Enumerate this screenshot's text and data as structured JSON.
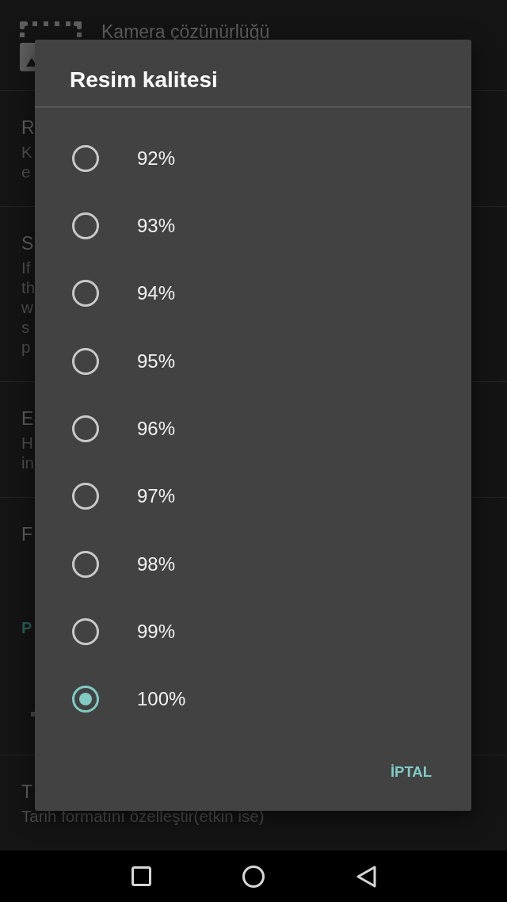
{
  "settings": [
    {
      "kind": "image_item",
      "title": "Kamera çözünürlüğü"
    },
    {
      "kind": "item",
      "title": "R",
      "summary": [
        "K",
        "e"
      ]
    },
    {
      "kind": "item",
      "title": "S",
      "summary": [
        "If",
        "th",
        "w",
        "s",
        "p"
      ]
    },
    {
      "kind": "item",
      "title": "E",
      "summary": [
        "H",
        "in"
      ]
    },
    {
      "kind": "item",
      "title": "F"
    },
    {
      "kind": "category",
      "title": "P"
    },
    {
      "kind": "slider"
    },
    {
      "kind": "item",
      "title": "T",
      "summary": [
        "Tarih formatını özelleştir(etkin ise)"
      ]
    }
  ],
  "dialog": {
    "title": "Resim kalitesi",
    "options": [
      {
        "label": "92%",
        "selected": false
      },
      {
        "label": "93%",
        "selected": false
      },
      {
        "label": "94%",
        "selected": false
      },
      {
        "label": "95%",
        "selected": false
      },
      {
        "label": "96%",
        "selected": false
      },
      {
        "label": "97%",
        "selected": false
      },
      {
        "label": "98%",
        "selected": false
      },
      {
        "label": "99%",
        "selected": false
      },
      {
        "label": "100%",
        "selected": true
      }
    ],
    "buttons": [
      "İPTAL"
    ]
  }
}
